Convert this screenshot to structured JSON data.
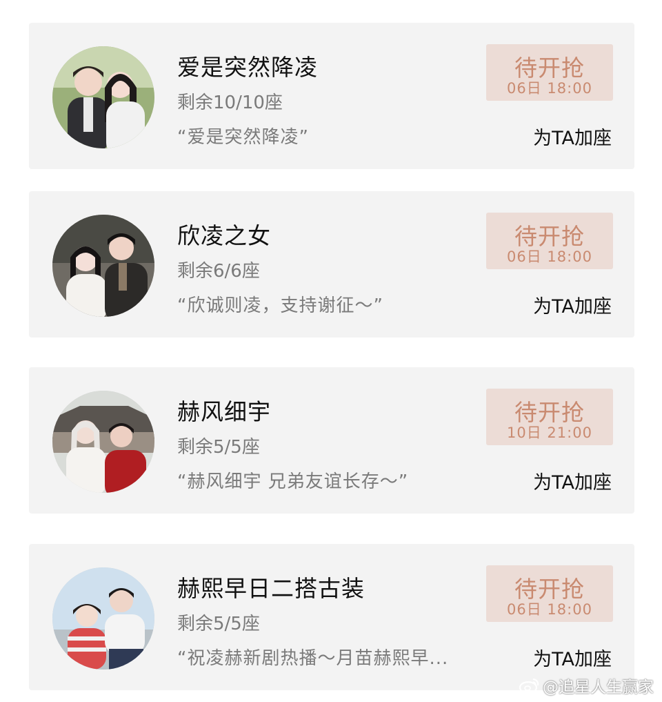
{
  "cards": [
    {
      "title": "爱是突然降凌",
      "seats": "剩余10/10座",
      "quote": "“爱是突然降凌”",
      "status_label": "待开抢",
      "status_time": "06日 18:00",
      "add_label": "为TA加座",
      "avatar_icon": "couple-photo-avatar"
    },
    {
      "title": "欣凌之女",
      "seats": "剩余6/6座",
      "quote": "“欣诚则凌，支持谢征～”",
      "status_label": "待开抢",
      "status_time": "06日 18:00",
      "add_label": "为TA加座",
      "avatar_icon": "couple-photo-avatar"
    },
    {
      "title": "赫风细宇",
      "seats": "剩余5/5座",
      "quote": "“赫风细宇 兄弟友谊长存～”",
      "status_label": "待开抢",
      "status_time": "10日 21:00",
      "add_label": "为TA加座",
      "avatar_icon": "duo-photo-avatar"
    },
    {
      "title": "赫熙早日二搭古装",
      "seats": "剩余5/5座",
      "quote": "“祝凌赫新剧热播～月苗赫熙早...",
      "status_label": "待开抢",
      "status_time": "06日 18:00",
      "add_label": "为TA加座",
      "avatar_icon": "couple-photo-avatar"
    }
  ],
  "watermark": {
    "text": "@追星人生赢家",
    "icon": "weibo-icon"
  },
  "colors": {
    "card_bg": "#f3f3f3",
    "status_bg": "#ecdcd6",
    "status_text": "#c98a70",
    "muted_text": "#7a7a7a"
  }
}
